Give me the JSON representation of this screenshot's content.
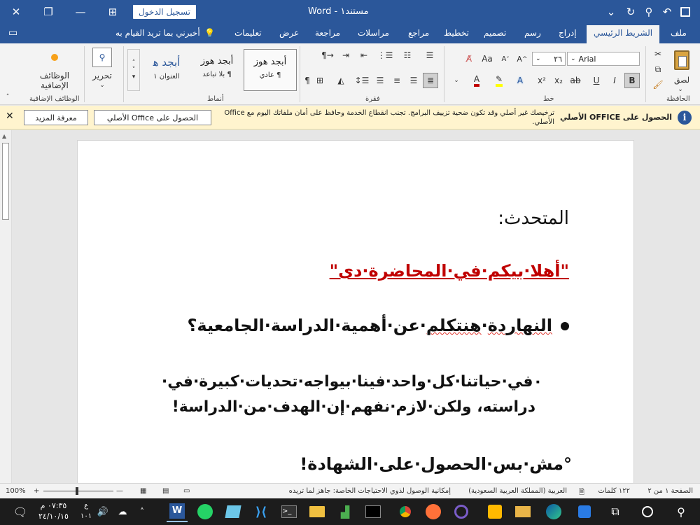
{
  "titlebar": {
    "doc_title": "مستند١ - Word",
    "signin_label": "تسجيل الدخول",
    "undo_icon": "↶",
    "redo_icon": "↻",
    "save_icon": "💾",
    "autosave_icon": "⌄",
    "search_icon": "⚲",
    "ribbon_display_icon": "⊞",
    "minimize_icon": "—",
    "maximize_icon": "❐",
    "close_icon": "✕"
  },
  "tabs": {
    "items": [
      "ملف",
      "الشريط الرئيسي",
      "إدراج",
      "رسم",
      "تصميم",
      "تخطيط",
      "مراجع",
      "مراسلات",
      "مراجعة",
      "عرض",
      "تعليمات"
    ],
    "active": "الشريط الرئيسي",
    "tell_me": "أخبرني بما تريد القيام به"
  },
  "ribbon": {
    "groups": {
      "clipboard": "الحافظة",
      "font": "خط",
      "paragraph": "فقرة",
      "styles": "أنماط",
      "editing": "",
      "addins": "الوظائف الإضافية"
    },
    "paste_label": "لصق",
    "font_name": "Arial",
    "font_size": "٢٦",
    "styles": [
      {
        "preview": "أبجد هوز",
        "name": "¶ عادي"
      },
      {
        "preview": "أبجد هوز",
        "name": "¶ بلا تباعد"
      },
      {
        "preview": "أبجد ﻫ",
        "name": "العنوان ١"
      }
    ],
    "editing_label": "تحرير",
    "addins_label": "الوظائف الإضافية",
    "font_buttons": [
      "B",
      "I",
      "U",
      "x₂",
      "x²",
      "A",
      "A",
      "A"
    ],
    "aa_label": "Aa",
    "colors": {
      "accent": "#2b579a",
      "red": "#c00000",
      "addin_dot": "#f7a11a"
    }
  },
  "infobar": {
    "title": "الحصول على OFFICE الأصلي",
    "message": "ترخيصك غير أصلي وقد تكون ضحية تزييف البرامج. تجنب انقطاع الخدمة وحافظ على أمان ملفاتك اليوم مع Office الأصلي.",
    "get_office_button": "الحصول على Office الأصلي",
    "learn_more_button": "معرفة المزيد"
  },
  "document": {
    "speaker": "المتحدث:",
    "welcome": "\"أهلا·بيكم·في·المحاضرة·دى\"",
    "bullet1": "النهاردة·هنتكلم·عن·أهمية·الدراسة·الجامعية؟",
    "para2_line1": "٠في·حياتنا·كل·واحد·فينا·بيواجه·تحديات·كبيرة·في·",
    "para2_line2": "دراسته، ولكن·لازم·نفهم·إن·الهدف·من·الدراسة!",
    "para3": "°مش·بس·الحصول·على·الشهادة!"
  },
  "statusbar": {
    "page": "الصفحة ١ من ٢",
    "words": "١٢٢ كلمات",
    "language": "العربية (المملكة العربية السعودية)",
    "accessibility": "إمكانية الوصول لذوي الاحتياجات الخاصة: جاهز لما تريده",
    "zoom": "100%"
  },
  "taskbar": {
    "time": "٠٧:٣٥ م",
    "date": "٢٤/١٠/١٥",
    "lang_line1": "ع",
    "lang_line2": "١٠١"
  }
}
